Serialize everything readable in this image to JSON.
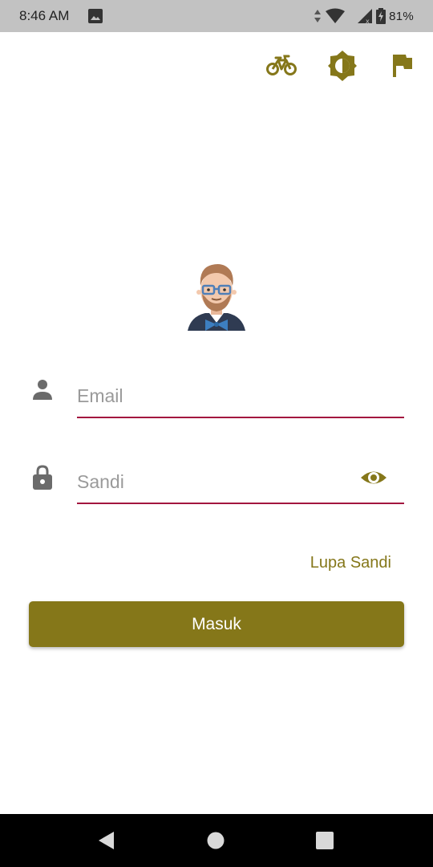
{
  "status_bar": {
    "time": "8:46 AM",
    "battery_percent": "81%",
    "icons": [
      "gallery-icon",
      "data-arrows-icon",
      "wifi-icon",
      "signal-icon",
      "battery-charging-icon"
    ]
  },
  "toolbar": {
    "icons": [
      "bike-icon",
      "brightness-contrast-icon",
      "flag-icon"
    ],
    "icon_color": "#85771a"
  },
  "login": {
    "email_placeholder": "Email",
    "password_placeholder": "Sandi",
    "forgot_password": "Lupa Sandi",
    "submit_label": "Masuk",
    "avatar_icon": "bearded-man-avatar",
    "field_icons": [
      "person-icon",
      "lock-icon",
      "eye-icon"
    ]
  },
  "nav_bar": {
    "icons": [
      "back-triangle-icon",
      "home-circle-icon",
      "recents-square-icon"
    ]
  },
  "colors": {
    "accent": "#857719",
    "underline": "#a3163f",
    "status_bar": "#c2c2c2",
    "nav_bar": "#000000"
  }
}
